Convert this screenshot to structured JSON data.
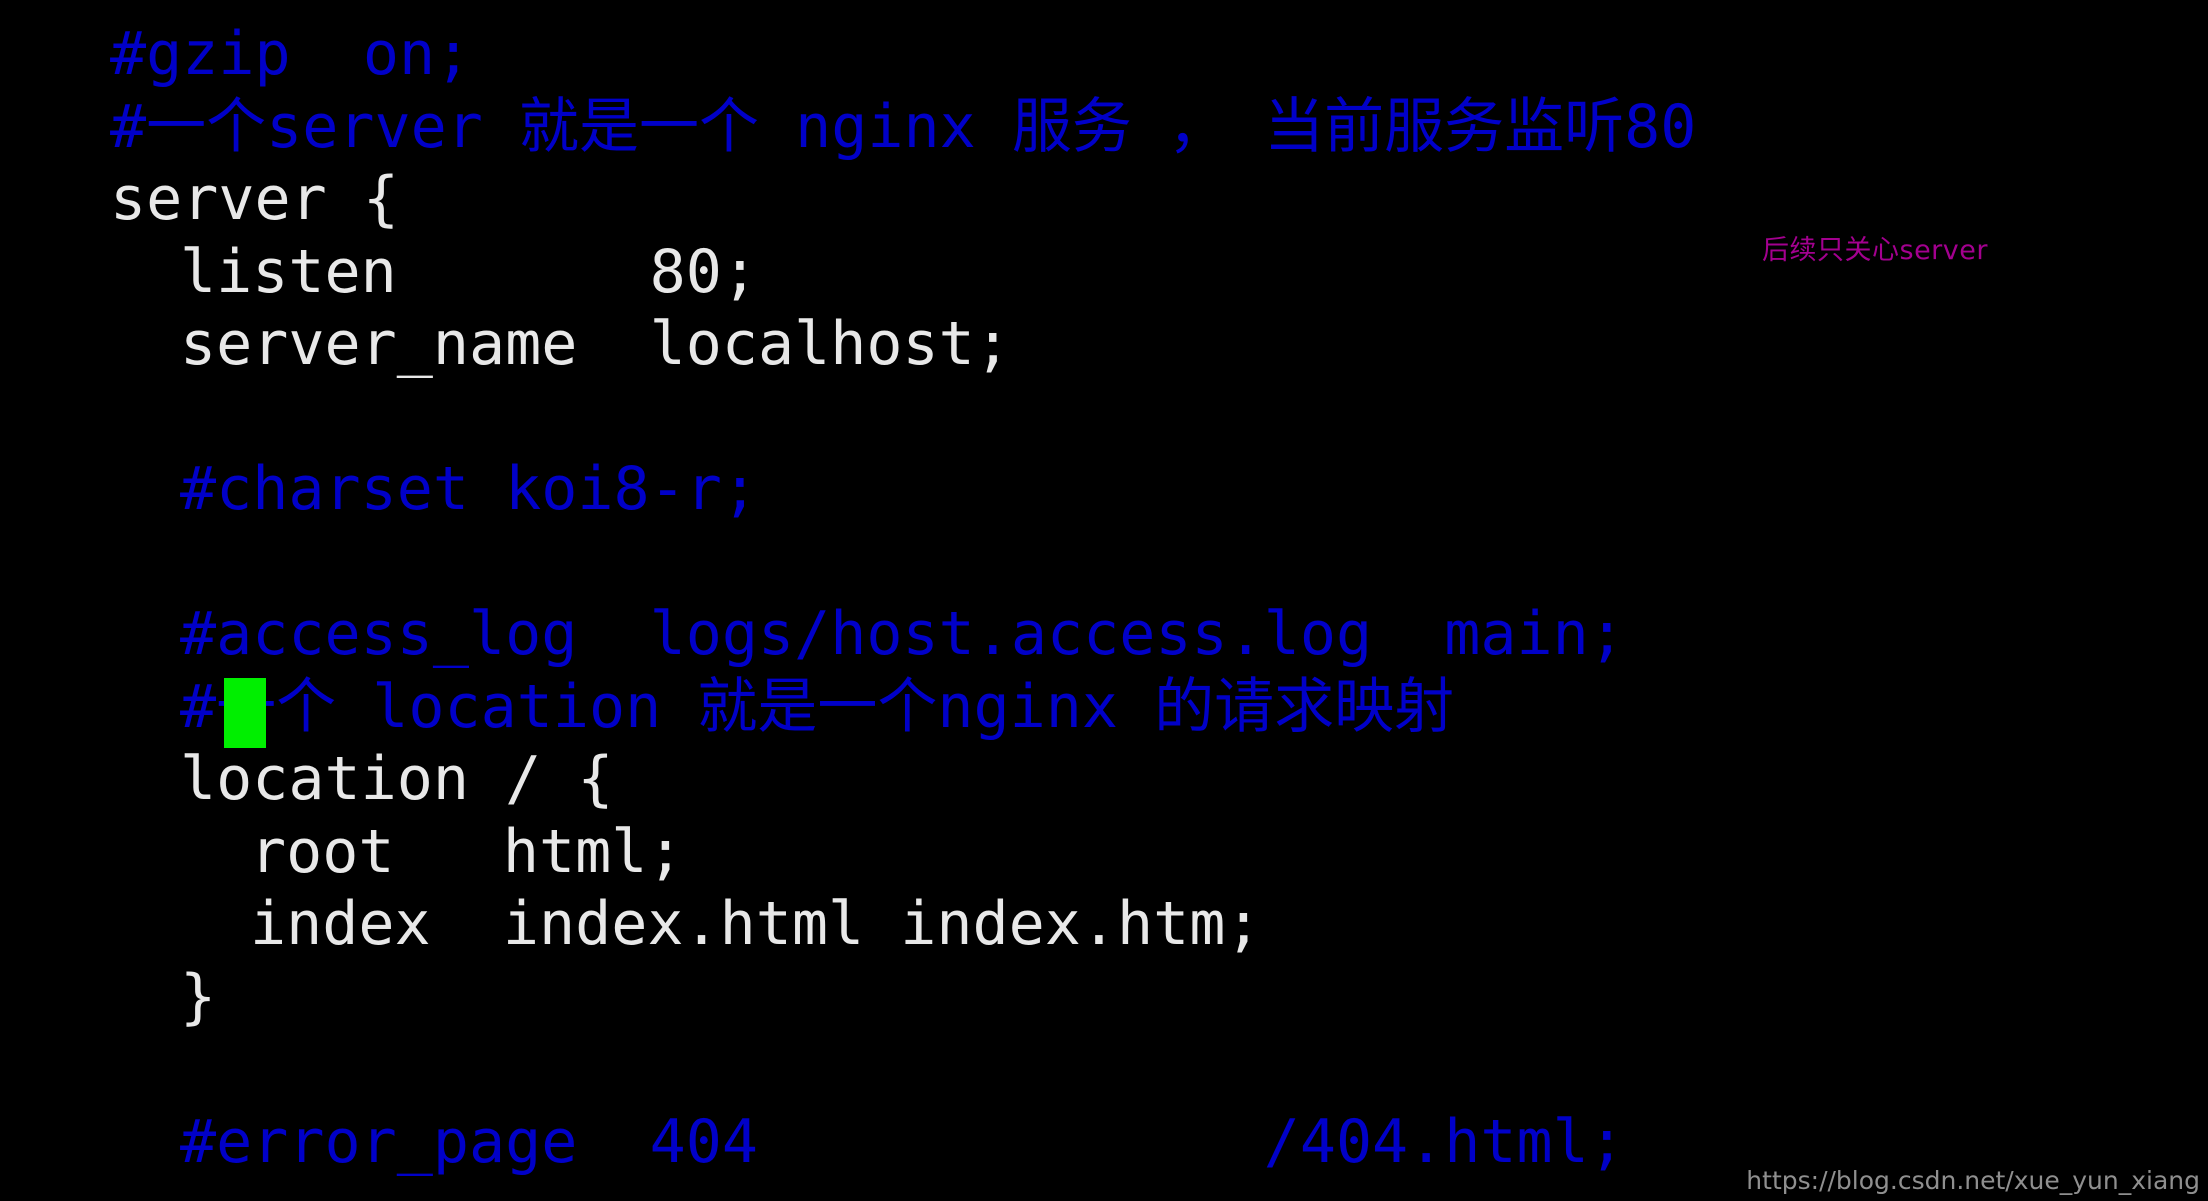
{
  "window": {
    "background_color": "#000000",
    "comment_color": "#0000c8",
    "code_color": "#e8e8e8",
    "cursor_color": "#00ef00",
    "annotation_color": "#a3008f",
    "watermark_color": "#8f8f8f"
  },
  "editor": {
    "lines": [
      {
        "indent": 0,
        "kind": "comment",
        "text": "#gzip  on;"
      },
      {
        "indent": 0,
        "kind": "comment",
        "text": "#一个server 就是一个 nginx 服务 ， 当前服务监听80"
      },
      {
        "indent": 0,
        "kind": "code",
        "text": "server {"
      },
      {
        "indent": 1,
        "kind": "code",
        "text": "listen       80;"
      },
      {
        "indent": 1,
        "kind": "code",
        "text": "server_name  localhost;"
      },
      {
        "indent": 0,
        "kind": "code",
        "text": ""
      },
      {
        "indent": 1,
        "kind": "comment",
        "text": "#charset koi8-r;"
      },
      {
        "indent": 0,
        "kind": "code",
        "text": ""
      },
      {
        "indent": 1,
        "kind": "comment",
        "text": "#access_log  logs/host.access.log  main;"
      },
      {
        "indent": 1,
        "kind": "comment",
        "text": "#一个 location 就是一个nginx 的请求映射"
      },
      {
        "indent": 1,
        "kind": "code",
        "text": "location / {"
      },
      {
        "indent": 2,
        "kind": "code",
        "text": "root   html;"
      },
      {
        "indent": 2,
        "kind": "code",
        "text": "index  index.html index.htm;"
      },
      {
        "indent": 1,
        "kind": "code",
        "text": "}"
      },
      {
        "indent": 0,
        "kind": "code",
        "text": ""
      },
      {
        "indent": 1,
        "kind": "comment",
        "text": "#error_page  404              /404.html;"
      }
    ]
  },
  "cursor": {
    "label": "block-cursor",
    "line_index": 9,
    "column": 0
  },
  "annotation": {
    "text": "后续只关心server"
  },
  "watermark": {
    "text": "https://blog.csdn.net/xue_yun_xiang"
  }
}
